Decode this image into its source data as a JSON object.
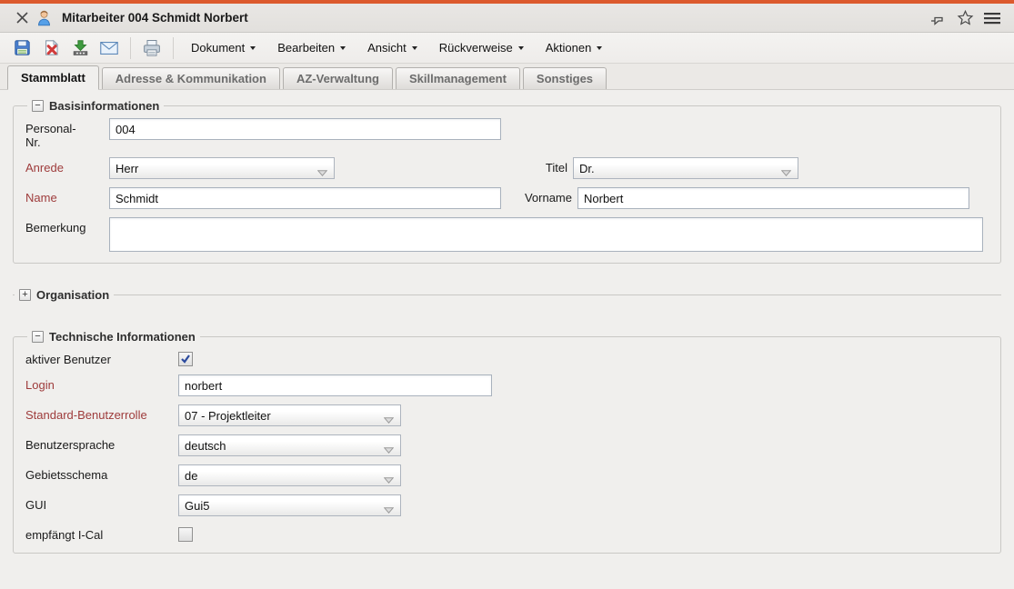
{
  "theme": {
    "accent_color": "#DC5A2D",
    "required_label_color": "#9E3B3B"
  },
  "titlebar": {
    "title": "Mitarbeiter 004 Schmidt Norbert"
  },
  "toolbar": {
    "buttons": [
      "save",
      "delete-document",
      "download",
      "email",
      "print"
    ],
    "menus": [
      "Dokument",
      "Bearbeiten",
      "Ansicht",
      "Rückverweise",
      "Aktionen"
    ]
  },
  "tabs": [
    "Stammblatt",
    "Adresse & Kommunikation",
    "AZ-Verwaltung",
    "Skillmanagement",
    "Sonstiges"
  ],
  "active_tab": "Stammblatt",
  "sections": {
    "basisinformationen": {
      "title": "Basisinformationen",
      "collapsed": false,
      "fields": {
        "personal_nr": {
          "label": "Personal-Nr.",
          "value": "004"
        },
        "anrede": {
          "label": "Anrede",
          "value": "Herr",
          "required": true
        },
        "titel": {
          "label": "Titel",
          "value": "Dr."
        },
        "name": {
          "label": "Name",
          "value": "Schmidt",
          "required": true
        },
        "vorname": {
          "label": "Vorname",
          "value": "Norbert"
        },
        "bemerkung": {
          "label": "Bemerkung",
          "value": ""
        }
      }
    },
    "organisation": {
      "title": "Organisation",
      "collapsed": true
    },
    "technische_informationen": {
      "title": "Technische Informationen",
      "collapsed": false,
      "fields": {
        "aktiver_benutzer": {
          "label": "aktiver Benutzer",
          "checked": true
        },
        "login": {
          "label": "Login",
          "value": "norbert",
          "required": true
        },
        "standard_benutzerrolle": {
          "label": "Standard-Benutzerrolle",
          "value": "07 - Projektleiter",
          "required": true
        },
        "benutzersprache": {
          "label": "Benutzersprache",
          "value": "deutsch"
        },
        "gebietsschema": {
          "label": "Gebietsschema",
          "value": "de"
        },
        "gui": {
          "label": "GUI",
          "value": "Gui5"
        },
        "empfaengt_ical": {
          "label": "empfängt I-Cal",
          "checked": false
        }
      }
    }
  }
}
